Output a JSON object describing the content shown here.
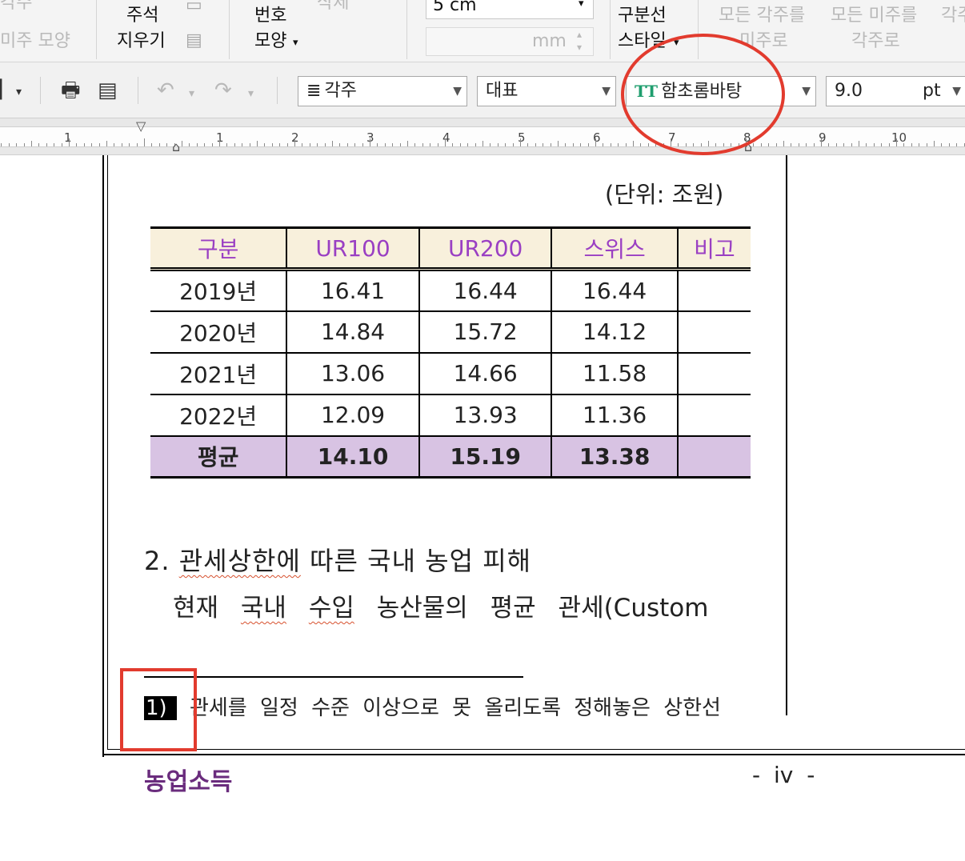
{
  "ribbon": {
    "top_left_cut": "각주",
    "endnote_shape": "미주 모양",
    "delete_note": [
      "주석",
      "지우기"
    ],
    "number_shape": [
      "번호",
      "모양"
    ],
    "delete_cut": "삭제",
    "size_value": "5 cm",
    "mm_unit": "mm",
    "divider_style": [
      "구분선",
      "스타일"
    ],
    "all_footnotes": [
      "모든 각주를",
      "미주로"
    ],
    "all_endnotes": [
      "모든 미주를",
      "각주로"
    ],
    "right_cut": "각주"
  },
  "toolbar": {
    "style_combo": "각주",
    "category_combo": "대표",
    "font_combo": "함초롬바탕",
    "font_icon": "TT",
    "size_combo": "9.0",
    "size_unit": "pt"
  },
  "ruler": {
    "labels": [
      "1",
      "1",
      "2",
      "3",
      "4",
      "5",
      "6",
      "7",
      "8",
      "9",
      "10"
    ]
  },
  "document": {
    "unit": "(단위: 조원)",
    "table": {
      "headers": [
        "구분",
        "UR100",
        "UR200",
        "스위스",
        "비고"
      ],
      "rows": [
        [
          "2019년",
          "16.41",
          "16.44",
          "16.44",
          ""
        ],
        [
          "2020년",
          "14.84",
          "15.72",
          "14.12",
          ""
        ],
        [
          "2021년",
          "13.06",
          "14.66",
          "11.58",
          ""
        ],
        [
          "2022년",
          "12.09",
          "13.93",
          "11.36",
          ""
        ]
      ],
      "average": [
        "평균",
        "14.10",
        "15.19",
        "13.38",
        ""
      ]
    },
    "heading_num": "2.",
    "heading_underlined": "관세상한에",
    "heading_rest": "따른 국내 농업 피해",
    "body_pre": "현재",
    "body_underlined": [
      "국내",
      "수입"
    ],
    "body_post": "농산물의 평균 관세(Custom",
    "footnote_marker": "1)",
    "footnote_text": "관세를 일정 수준 이상으로 못 올리도록 정해놓은 상한선",
    "footer_title": "농업소득",
    "page_number": "- iv -"
  }
}
